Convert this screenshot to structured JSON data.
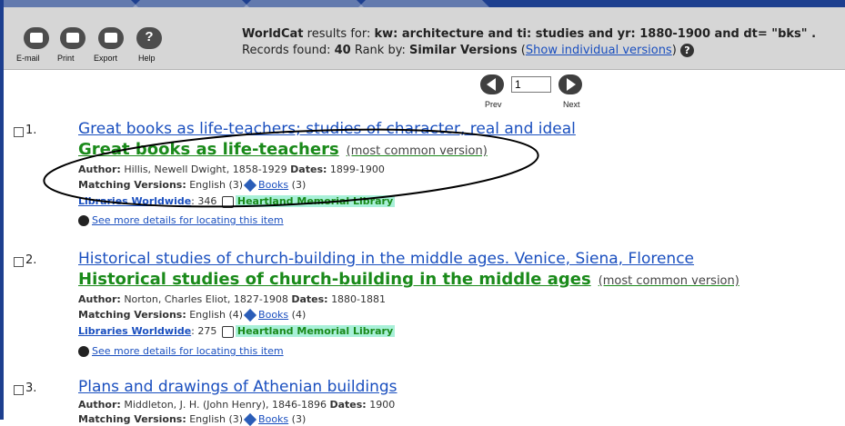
{
  "toolbar": {
    "buttons": [
      {
        "label": "E-mail",
        "icon": "email-icon"
      },
      {
        "label": "Print",
        "icon": "print-icon"
      },
      {
        "label": "Export",
        "icon": "export-icon"
      },
      {
        "label": "Help",
        "icon": "help-icon"
      }
    ],
    "results_prefix": "WorldCat",
    "results_for": "results for:",
    "query": "kw: architecture and ti: studies and yr: 1880-1900 and dt= \"bks\" .",
    "records_found_label": "Records found:",
    "records_found": "40",
    "rank_by_label": "Rank by:",
    "rank_by": "Similar Versions",
    "show_individual": "Show individual versions"
  },
  "pager": {
    "prev_label": "Prev",
    "next_label": "Next",
    "page_value": "1"
  },
  "records": [
    {
      "num": "1.",
      "title": "Great books as life-teachers; studies of character, real and ideal",
      "common_title": "Great books as life-teachers",
      "common_note": "(most common version)",
      "author_label": "Author:",
      "author": "Hillis, Newell Dwight, 1858-1929",
      "dates_label": "Dates:",
      "dates": "1899-1900",
      "matching_label": "Matching Versions:",
      "matching": "English (3)",
      "format_link": "Books",
      "format_count": "(3)",
      "libraries_label": "Libraries Worldwide",
      "libraries_count": ": 346",
      "library_name": "Heartland Memorial Library",
      "details_link": "See more details for locating this item"
    },
    {
      "num": "2.",
      "title": "Historical studies of church-building in the middle ages. Venice, Siena, Florence",
      "common_title": "Historical studies of church-building in the middle ages",
      "common_note": "(most common version)",
      "author_label": "Author:",
      "author": "Norton, Charles Eliot, 1827-1908",
      "dates_label": "Dates:",
      "dates": "1880-1881",
      "matching_label": "Matching Versions:",
      "matching": "English (4)",
      "format_link": "Books",
      "format_count": "(4)",
      "libraries_label": "Libraries Worldwide",
      "libraries_count": ": 275",
      "library_name": "Heartland Memorial Library",
      "details_link": "See more details for locating this item"
    },
    {
      "num": "3.",
      "title": "Plans and drawings of Athenian buildings",
      "author_label": "Author:",
      "author": "Middleton, J. H. (John Henry), 1846-1896",
      "dates_label": "Dates:",
      "dates": "1900",
      "matching_label": "Matching Versions:",
      "matching": "English (3)",
      "format_link": "Books",
      "format_count": "(3)"
    }
  ],
  "colors": {
    "accent_blue": "#1d3f8f",
    "link_blue": "#1a4fbf",
    "green_title": "#1a8a1a",
    "library_highlight": "#a8f0d8"
  }
}
